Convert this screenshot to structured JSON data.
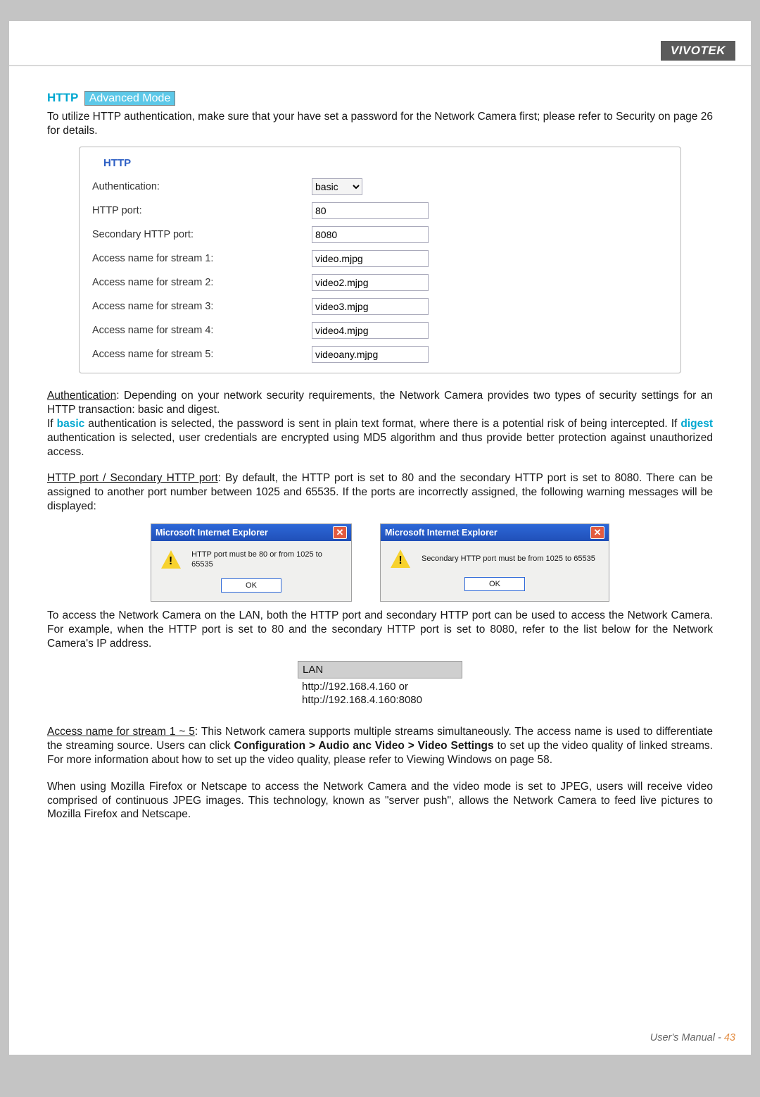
{
  "brand": "VIVOTEK",
  "heading": {
    "http": "HTTP",
    "adv": "Advanced Mode"
  },
  "intro": "To utilize HTTP authentication, make sure that your have set a password for the Network Camera first; please refer to Security on page 26 for details.",
  "fieldset": {
    "legend": "HTTP",
    "rows": {
      "auth_label": "Authentication:",
      "auth_value": "basic",
      "port_label": "HTTP port:",
      "port_value": "80",
      "sport_label": "Secondary HTTP port:",
      "sport_value": "8080",
      "s1_label": "Access name for stream 1:",
      "s1_value": "video.mjpg",
      "s2_label": "Access name for stream 2:",
      "s2_value": "video2.mjpg",
      "s3_label": "Access name for stream 3:",
      "s3_value": "video3.mjpg",
      "s4_label": "Access name for stream 4:",
      "s4_value": "video4.mjpg",
      "s5_label": "Access name for stream 5:",
      "s5_value": "videoany.mjpg"
    }
  },
  "auth_para": {
    "lead": "Authentication",
    "text1": ": Depending on your network security requirements, the Network Camera provides two types of security settings for an HTTP transaction: basic and digest.",
    "line2a": "If ",
    "basic": "basic",
    "line2b": " authentication is selected, the password is sent in plain text format, where there is a potential risk of being intercepted. If ",
    "digest": "digest",
    "line2c": " authentication is selected, user credentials are encrypted using MD5 algorithm and thus provide better protection against unauthorized access."
  },
  "port_para": {
    "lead": "HTTP port / Secondary HTTP port",
    "text": ": By default, the HTTP port is set to 80 and the secondary HTTP port is set to 8080. There can be assigned to another port number between 1025 and 65535. If the ports are incorrectly assigned, the following warning messages will be displayed:"
  },
  "dialogs": {
    "title": "Microsoft Internet Explorer",
    "msg1": "HTTP port must be 80 or from 1025 to 65535",
    "msg2": "Secondary HTTP port must be from 1025 to 65535",
    "ok": "OK"
  },
  "access_para": "To access the Network Camera on the LAN, both the HTTP port and secondary HTTP port can be used to access the Network Camera. For example, when the HTTP port is set to 80 and the secondary HTTP port is set to 8080, refer to the list below for the Network Camera's IP address.",
  "lan": {
    "head": "LAN",
    "l1": "http://192.168.4.160  or",
    "l2": "http://192.168.4.160:8080"
  },
  "stream_para": {
    "lead": "Access name for stream 1 ~ 5",
    "t1": ": This Network camera supports multiple streams simultaneously. The access name is used to differentiate the streaming source. Users can click ",
    "bold": "Configuration > Audio anc Video > Video Settings",
    "t2": " to set up the video quality of linked streams. For more information about how to set up the video quality, please refer to Viewing Windows on page 58."
  },
  "moz_para": "When using Mozilla Firefox or Netscape to access the Network Camera and the video mode is set to JPEG, users will receive video comprised of continuous JPEG images. This technology, known as \"server push\", allows the Network Camera to feed live pictures to Mozilla Firefox and Netscape.",
  "footer": {
    "label": "User's Manual - ",
    "page": "43"
  }
}
